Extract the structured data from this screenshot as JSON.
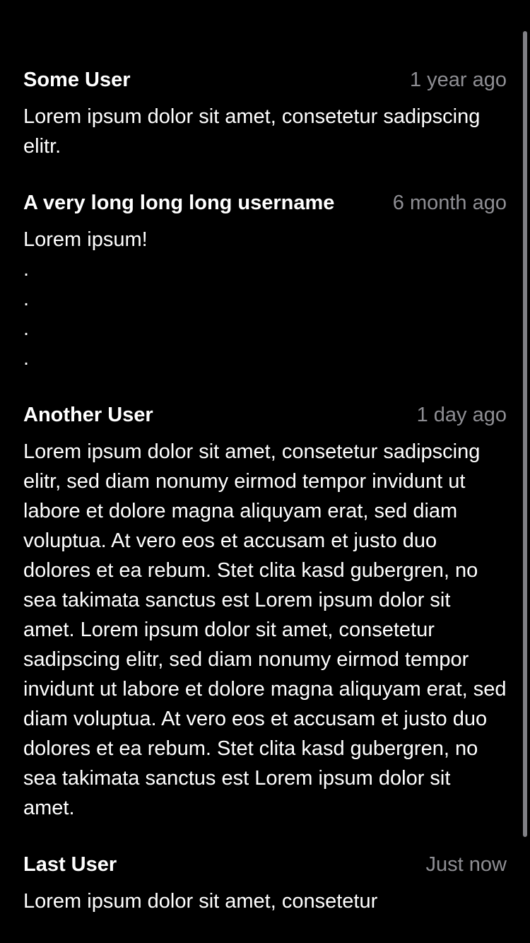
{
  "comments": [
    {
      "username": "Some User",
      "timestamp": "1 year ago",
      "text": "Lorem ipsum dolor sit amet, consetetur sadipscing elitr."
    },
    {
      "username": "A very long long long username",
      "timestamp": "6 month ago",
      "text": "Lorem ipsum!\n.\n.\n.\n."
    },
    {
      "username": "Another User",
      "timestamp": "1 day ago",
      "text": "Lorem ipsum dolor sit amet, consetetur sadipscing elitr, sed diam nonumy eirmod tempor invidunt ut labore et dolore magna aliquyam erat, sed diam voluptua. At vero eos et accusam et justo duo dolores et ea rebum. Stet clita kasd gubergren, no sea takimata sanctus est Lorem ipsum dolor sit amet. Lorem ipsum dolor sit amet, consetetur sadipscing elitr, sed diam nonumy eirmod tempor invidunt ut labore et dolore magna aliquyam erat, sed diam voluptua. At vero eos et accusam et justo duo dolores et ea rebum. Stet clita kasd gubergren, no sea takimata sanctus est Lorem ipsum dolor sit amet."
    },
    {
      "username": "Last User",
      "timestamp": "Just now",
      "text": "Lorem ipsum dolor sit amet, consetetur"
    }
  ],
  "colors": {
    "background": "#000000",
    "text": "#ffffff",
    "secondary": "#8e8e93"
  }
}
